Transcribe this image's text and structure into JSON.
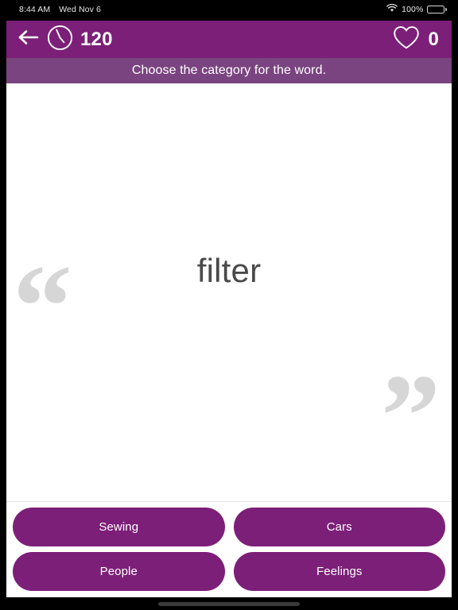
{
  "status_bar": {
    "time": "8:44 AM",
    "date": "Wed Nov 6",
    "wifi_icon": "wifi-icon",
    "battery_percent": "100%",
    "battery_icon": "battery-full-icon"
  },
  "nav_bar": {
    "back_icon": "back-arrow-icon",
    "timer_icon": "clock-icon",
    "timer_value": "120",
    "lives_icon": "heart-icon",
    "lives_value": "0",
    "background_color": "#7c1f78"
  },
  "instruction": {
    "text": "Choose the category for the word.",
    "background_color": "#7a4480"
  },
  "card": {
    "quote_open": "“",
    "quote_close": "”",
    "word": "filter",
    "word_color": "#4a4a4a",
    "quote_color": "#d6d6d6"
  },
  "answers": {
    "button_color": "#7c1f78",
    "rows": [
      [
        {
          "label": "Sewing"
        },
        {
          "label": "Cars"
        }
      ],
      [
        {
          "label": "People"
        },
        {
          "label": "Feelings"
        }
      ]
    ]
  }
}
